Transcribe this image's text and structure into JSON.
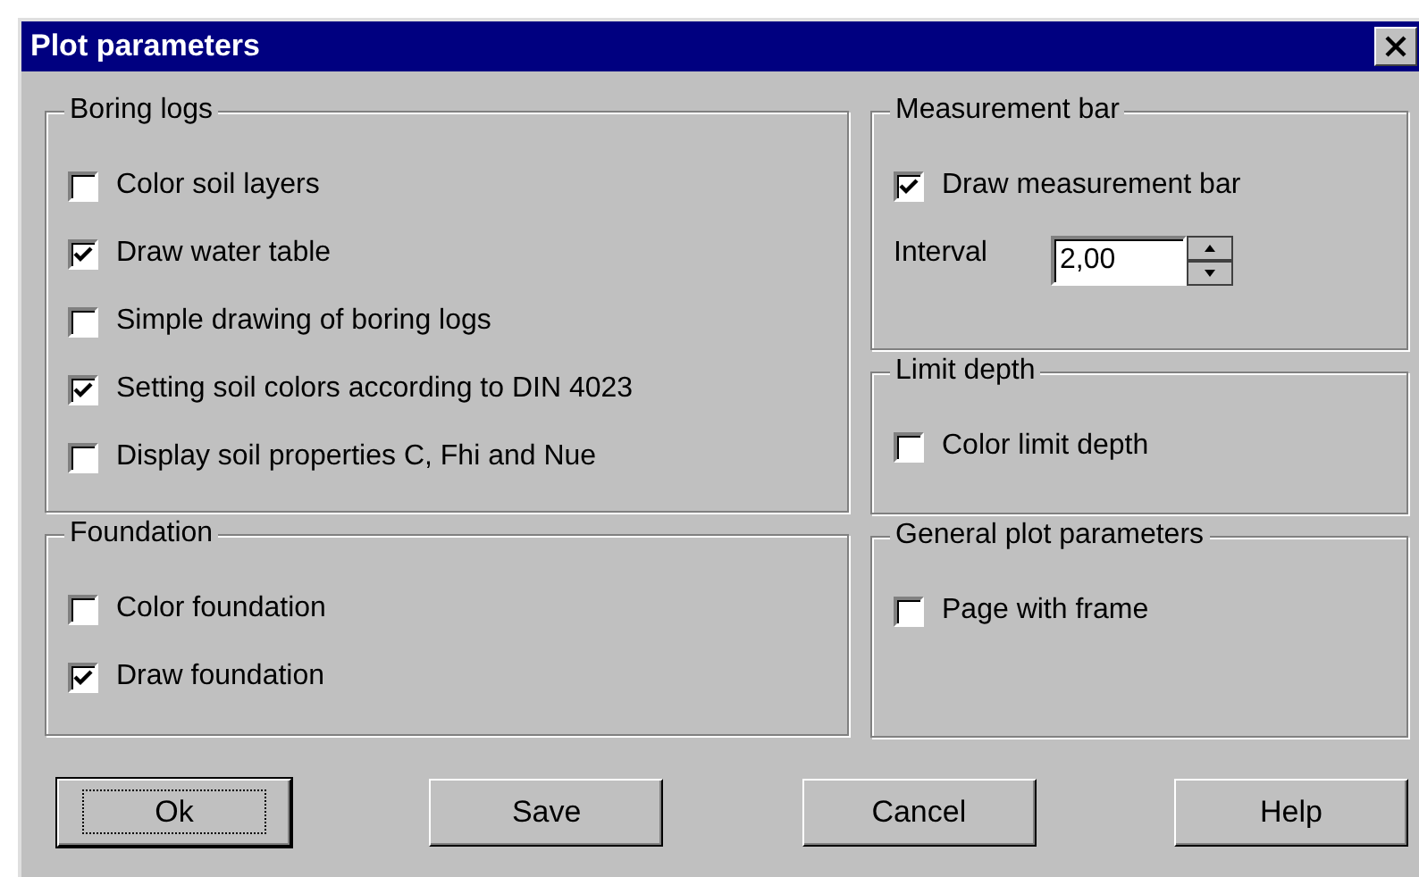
{
  "window": {
    "title": "Plot parameters"
  },
  "columns": [
    {
      "groups": [
        {
          "title": "Boring logs",
          "items": [
            {
              "kind": "checkbox",
              "label": "Color soil layers",
              "checked": false
            },
            {
              "kind": "checkbox",
              "label": "Draw water table",
              "checked": true
            },
            {
              "kind": "checkbox",
              "label": "Simple drawing of boring logs",
              "checked": false
            },
            {
              "kind": "checkbox",
              "label": "Setting soil colors according to DIN 4023",
              "checked": true
            },
            {
              "kind": "checkbox",
              "label": "Display soil properties C, Fhi and Nue",
              "checked": false
            }
          ]
        },
        {
          "title": "Foundation",
          "items": [
            {
              "kind": "checkbox",
              "label": "Color foundation",
              "checked": false
            },
            {
              "kind": "checkbox",
              "label": "Draw foundation",
              "checked": true
            }
          ]
        }
      ]
    },
    {
      "groups": [
        {
          "title": "Measurement bar",
          "items": [
            {
              "kind": "checkbox",
              "label": "Draw measurement bar",
              "checked": true
            },
            {
              "kind": "spinner",
              "label": "Interval",
              "value": "2,00"
            }
          ]
        },
        {
          "title": "Limit depth",
          "items": [
            {
              "kind": "checkbox",
              "label": "Color limit depth",
              "checked": false
            }
          ]
        },
        {
          "title": "General plot parameters",
          "items": [
            {
              "kind": "checkbox",
              "label": "Page with frame",
              "checked": false
            }
          ]
        }
      ]
    }
  ],
  "buttons": [
    {
      "label": "Ok",
      "default": true
    },
    {
      "label": "Save",
      "default": false
    },
    {
      "label": "Cancel",
      "default": false
    },
    {
      "label": "Help",
      "default": false
    }
  ]
}
